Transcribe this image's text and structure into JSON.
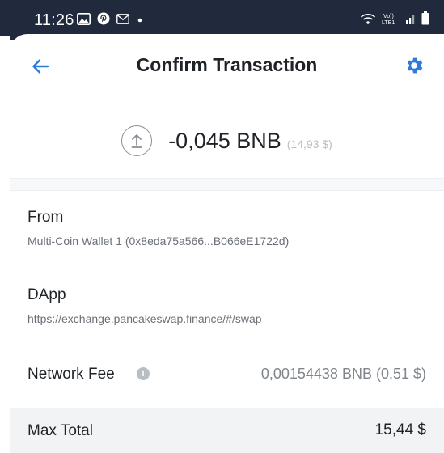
{
  "status_bar": {
    "time": "11:26",
    "left_icons": [
      "gallery-icon",
      "pinterest-icon",
      "gmail-icon",
      "dot-icon"
    ],
    "right_icons": [
      "wifi-icon",
      "volte-icon",
      "signal-icon",
      "battery-icon"
    ],
    "volte_label": "Vo))\nLTE1"
  },
  "header": {
    "title": "Confirm Transaction",
    "back_icon": "arrow-left-icon",
    "settings_icon": "gear-icon",
    "accent_color": "#2f7bd6"
  },
  "amount": {
    "icon": "arrow-up-circle-icon",
    "value": "-0,045 BNB",
    "fiat": "(14,93 $)"
  },
  "details": {
    "from": {
      "label": "From",
      "value": "Multi-Coin Wallet 1 (0x8eda75a566...B066eE1722d)"
    },
    "dapp": {
      "label": "DApp",
      "value": "https://exchange.pancakeswap.finance/#/swap"
    },
    "network_fee": {
      "label": "Network Fee",
      "info_icon": "info-icon",
      "value": "0,00154438 BNB (0,51 $)"
    },
    "max_total": {
      "label": "Max Total",
      "value": "15,44 $"
    }
  }
}
